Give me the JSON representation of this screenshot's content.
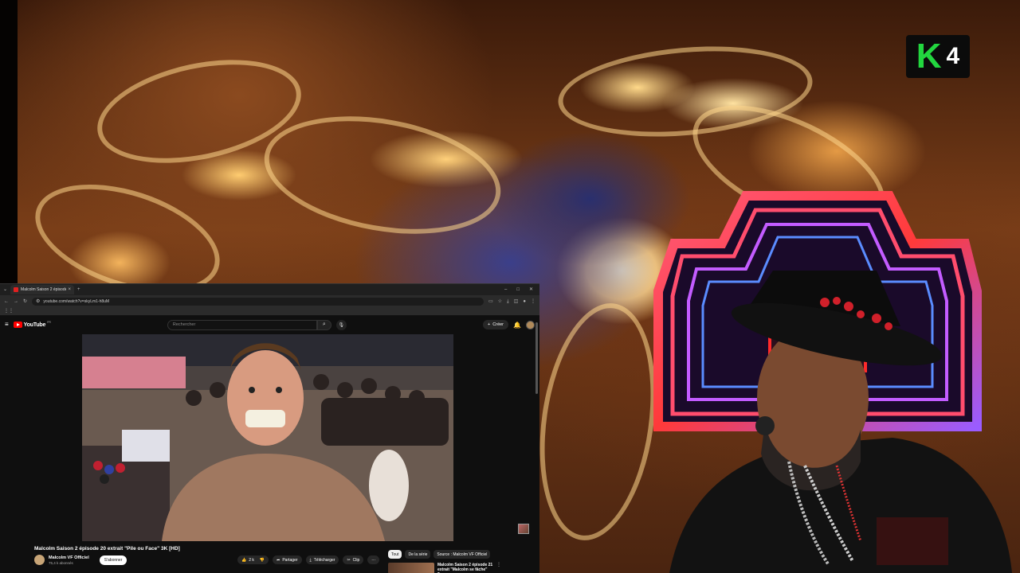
{
  "overlay": {
    "channel_logo_letter": "K",
    "channel_logo_number": "4",
    "channel_logo_color": "#22d63f"
  },
  "browser": {
    "tab_title": "Malcolm Saison 2 épisode",
    "tab_close": "×",
    "new_tab": "+",
    "url": "youtube.com/watch?v=skyLm1-h8uM"
  },
  "youtube": {
    "brand_color": "#ff0000",
    "logo_text": "YouTube",
    "logo_sup": "FR",
    "search_placeholder": "Rechercher",
    "create_label": "Créer",
    "video_title": "Malcolm Saison 2 épisode 20 extrait \"Pile ou Face\" 3K [HD]",
    "channel_name": "Malcolm VF Officiel",
    "channel_subs": "75,4 k abonnés",
    "subscribe_label": "S'abonner",
    "likes": "2 k",
    "share_label": "Partager",
    "download_label": "Télécharger",
    "clip_label": "Clip",
    "more_label": "···",
    "filters": [
      "Tout",
      "De la série",
      "Source : Malcolm VF Officiel"
    ],
    "recommendation_title": "Malcolm Saison 2 épisode 21 extrait \"Malcolm se fâche\" 3..."
  }
}
